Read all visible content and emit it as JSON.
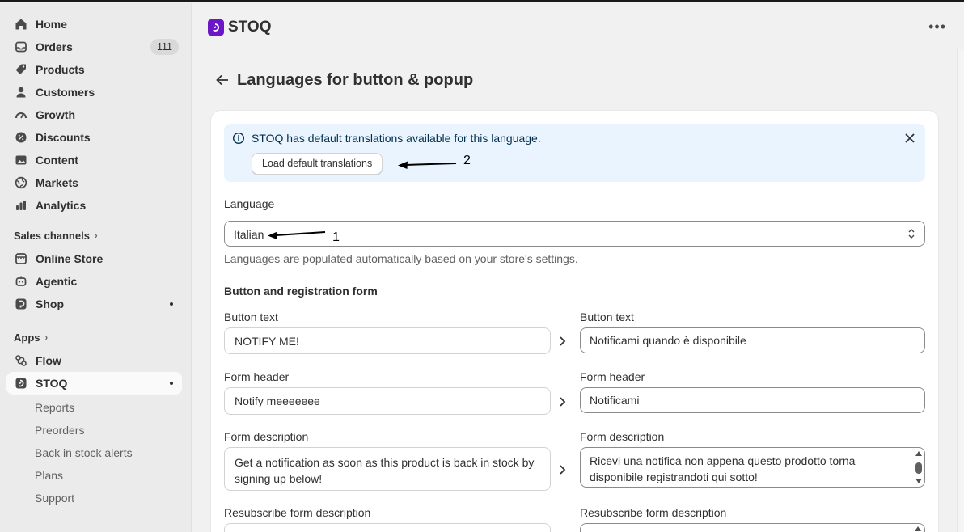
{
  "sidebar": {
    "items": [
      {
        "label": "Home",
        "icon": "home-icon"
      },
      {
        "label": "Orders",
        "icon": "inbox-icon",
        "badge": "111"
      },
      {
        "label": "Products",
        "icon": "tag-icon"
      },
      {
        "label": "Customers",
        "icon": "person-icon"
      },
      {
        "label": "Growth",
        "icon": "gauge-icon"
      },
      {
        "label": "Discounts",
        "icon": "discount-icon"
      },
      {
        "label": "Content",
        "icon": "image-icon"
      },
      {
        "label": "Markets",
        "icon": "globe-icon"
      },
      {
        "label": "Analytics",
        "icon": "chart-icon"
      }
    ],
    "sales_channels": {
      "title": "Sales channels",
      "items": [
        {
          "label": "Online Store",
          "icon": "store-icon"
        },
        {
          "label": "Agentic",
          "icon": "robot-icon"
        },
        {
          "label": "Shop",
          "icon": "shop-icon"
        }
      ]
    },
    "apps": {
      "title": "Apps",
      "items": [
        {
          "label": "Flow",
          "icon": "flow-icon"
        },
        {
          "label": "STOQ",
          "icon": "stoq-icon"
        }
      ],
      "sub_items": [
        "Reports",
        "Preorders",
        "Back in stock alerts",
        "Plans",
        "Support"
      ]
    }
  },
  "topbar": {
    "app_name": "STOQ",
    "brand_color": "#6b16c7",
    "more": "•••"
  },
  "page": {
    "title": "Languages for button & popup"
  },
  "banner": {
    "message": "STOQ has default translations available for this language.",
    "button": "Load default translations",
    "background": "#eaf4ff"
  },
  "annotations": {
    "one": "1",
    "two": "2"
  },
  "language": {
    "label": "Language",
    "value": "Italian",
    "helper": "Languages are populated automatically based on your store's settings."
  },
  "form": {
    "section_title": "Button and registration form",
    "fields": [
      {
        "label": "Button text",
        "source": "NOTIFY ME!",
        "target_label": "Button text",
        "target": "Notificami quando è disponibile"
      },
      {
        "label": "Form header",
        "source": "Notify meeeeeee",
        "target_label": "Form header",
        "target": "Notificami"
      },
      {
        "label": "Form description",
        "source": "Get a notification as soon as this product is back in stock by signing up below!",
        "target_label": "Form description",
        "target": "Ricevi una notifica non appena questo prodotto torna disponibile registrandoti qui sotto!"
      },
      {
        "label": "Resubscribe form description",
        "target_label": "Resubscribe form description"
      }
    ]
  }
}
